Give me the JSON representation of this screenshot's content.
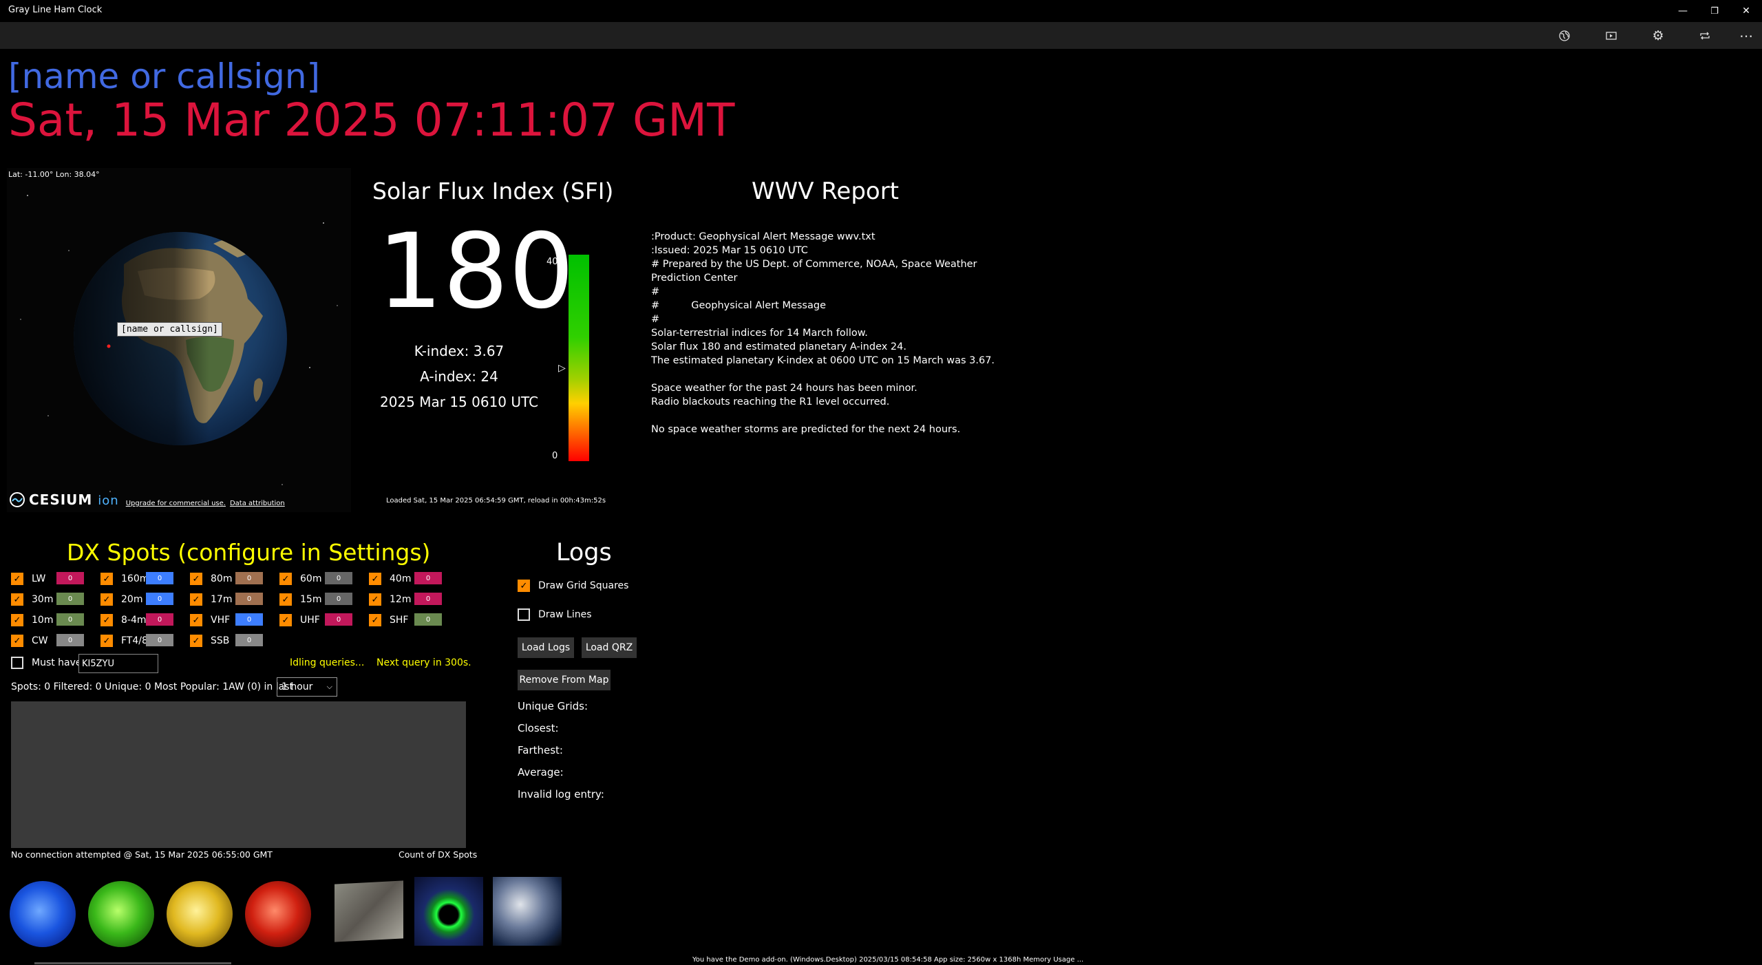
{
  "window": {
    "title": "Gray Line Ham Clock",
    "controls": [
      "minimize-icon",
      "restore-icon",
      "close-icon"
    ]
  },
  "toolbar": {
    "buttons": [
      "globe-icon",
      "slideshow-icon",
      "gear-icon",
      "repeat-icon",
      "more-icon"
    ]
  },
  "header": {
    "name": "[name or callsign]",
    "datetime": "Sat, 15 Mar 2025 07:11:07 GMT"
  },
  "globe": {
    "latlon": "Lat: -11.00° Lon: 38.04°",
    "label": "[name or callsign]",
    "cesium_logo": "CESIUM",
    "cesium_ion": "ion",
    "upgrade_link": "Upgrade for commercial use.",
    "attribution_link": "Data attribution"
  },
  "sfi": {
    "title": "Solar Flux Index (SFI)",
    "value": "180",
    "k_index": "K-index:  3.67",
    "a_index": "A-index:  24",
    "timestamp": "2025 Mar 15 0610 UTC",
    "scale_max": "400",
    "scale_min": "0",
    "level_fraction": 0.45,
    "loaded": "Loaded Sat, 15 Mar 2025 06:54:59 GMT, reload in 00h:43m:52s"
  },
  "wwv": {
    "title": "WWV Report",
    "text": ":Product: Geophysical Alert Message wwv.txt\n:Issued: 2025 Mar 15 0610 UTC\n# Prepared by the US Dept. of Commerce, NOAA, Space Weather Prediction Center\n#\n#          Geophysical Alert Message\n#\nSolar-terrestrial indices for 14 March follow.\nSolar flux 180 and estimated planetary A-index 24.\nThe estimated planetary K-index at 0600 UTC on 15 March was 3.67.\n\nSpace weather for the past 24 hours has been minor.\nRadio blackouts reaching the R1 level occurred.\n\nNo space weather storms are predicted for the next 24 hours."
  },
  "dx": {
    "title": "DX Spots (configure in Settings)",
    "bands": [
      {
        "label": "LW",
        "count": "0",
        "color": "#c2185b"
      },
      {
        "label": "160m",
        "count": "0",
        "color": "#3d7eff"
      },
      {
        "label": "80m",
        "count": "0",
        "color": "#a07050"
      },
      {
        "label": "60m",
        "count": "0",
        "color": "#666666"
      },
      {
        "label": "40m",
        "count": "0",
        "color": "#c2185b"
      },
      {
        "label": "30m",
        "count": "0",
        "color": "#6a8a50"
      },
      {
        "label": "20m",
        "count": "0",
        "color": "#3d7eff"
      },
      {
        "label": "17m",
        "count": "0",
        "color": "#a07050"
      },
      {
        "label": "15m",
        "count": "0",
        "color": "#666666"
      },
      {
        "label": "12m",
        "count": "0",
        "color": "#c2185b"
      },
      {
        "label": "10m",
        "count": "0",
        "color": "#6a8a50"
      },
      {
        "label": "8-4m",
        "count": "0",
        "color": "#c2185b"
      },
      {
        "label": "VHF",
        "count": "0",
        "color": "#3d7eff"
      },
      {
        "label": "UHF",
        "count": "0",
        "color": "#c2185b"
      },
      {
        "label": "SHF",
        "count": "0",
        "color": "#6a8a50"
      },
      {
        "label": "CW",
        "count": "0",
        "color": "#888888"
      },
      {
        "label": "FT4/8",
        "count": "0",
        "color": "#888888"
      },
      {
        "label": "SSB",
        "count": "0",
        "color": "#888888"
      }
    ],
    "must_have_label": "Must have",
    "must_have_value": "KI5ZYU",
    "idling": "Idling queries...",
    "next_query": "Next query in 300s.",
    "stats": "Spots: 0   Filtered:  0   Unique:  0   Most Popular:  1AW (0) in last",
    "period": "1 hour",
    "no_connection": "No connection attempted @ Sat, 15 Mar 2025 06:55:00 GMT",
    "count_label": "Count of DX Spots"
  },
  "logs": {
    "title": "Logs",
    "draw_grid": "Draw Grid Squares",
    "draw_lines": "Draw Lines",
    "load_logs": "Load Logs",
    "load_qrz": "Load QRZ",
    "remove": "Remove From Map",
    "unique_grids": "Unique Grids:",
    "closest": "Closest:",
    "farthest": "Farthest:",
    "average": "Average:",
    "invalid": "Invalid log entry:"
  },
  "status": {
    "text": "You have the Demo add-on.  (Windows.Desktop) 2025/03/15 08:54:58   App size:  2560w x 1368h    Memory Usage          ..."
  }
}
